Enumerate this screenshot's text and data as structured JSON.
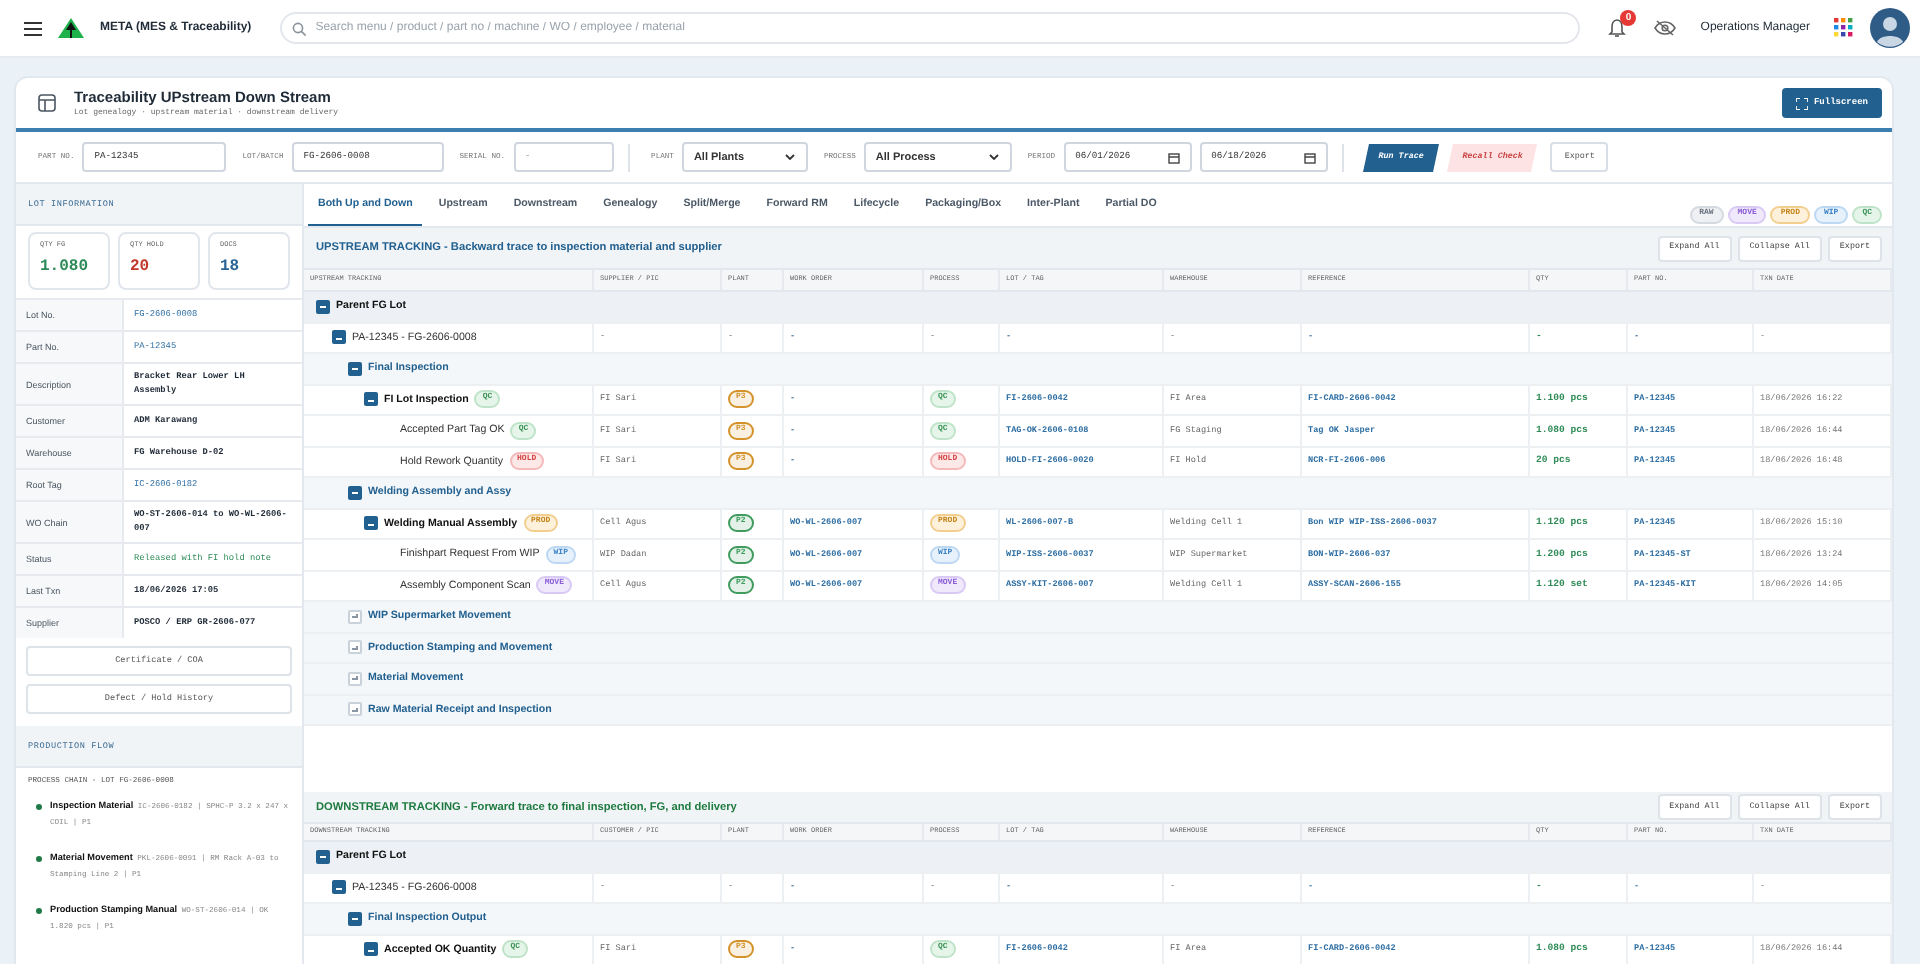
{
  "topbar": {
    "app_title": "META (MES & Traceability)",
    "search": {
      "placeholder": "Search menu / product / part no / machine / WO / employee / material"
    },
    "notification_count": "0",
    "user_name": "Operations Manager"
  },
  "page": {
    "title": "Traceability UPstream Down Stream",
    "subtitle": "Lot genealogy · upstream material · downstream delivery",
    "fullscreen_button": "Fullscreen"
  },
  "filters": [
    {
      "kind": "text",
      "label": "PART NO.",
      "value": "PA-12345"
    },
    {
      "kind": "text",
      "label": "LOT/BATCH",
      "value": "FG-2606-0008"
    },
    {
      "kind": "text",
      "label": "SERIAL NO.",
      "placeholder": "-"
    },
    {
      "kind": "select",
      "label": "PLANT",
      "value": "All Plants"
    },
    {
      "kind": "select",
      "label": "PROCESS",
      "value": "All Process"
    },
    {
      "kind": "daterange",
      "label": "PERIOD",
      "values": [
        "06/01/2026",
        "06/18/2026"
      ]
    }
  ],
  "filter_actions": [
    {
      "kind": "primary",
      "label": "Run Trace"
    },
    {
      "kind": "danger",
      "label": "Recall Check"
    },
    {
      "kind": "plain",
      "label": "Export"
    }
  ],
  "lot_info": {
    "heading": "LOT INFORMATION",
    "stats": [
      {
        "kind": "good",
        "label": "QTY FG",
        "value": "1.080"
      },
      {
        "kind": "bad",
        "label": "QTY HOLD",
        "value": "20"
      },
      {
        "kind": "info",
        "label": "DOCS",
        "value": "18"
      }
    ],
    "fields": [
      {
        "kind": "link",
        "label": "Lot No.",
        "value": "FG-2606-0008"
      },
      {
        "kind": "link",
        "label": "Part No.",
        "value": "PA-12345"
      },
      {
        "kind": "text",
        "label": "Description",
        "value": "Bracket Rear Lower LH Assembly"
      },
      {
        "kind": "text",
        "label": "Customer",
        "value": "ADM Karawang"
      },
      {
        "kind": "text",
        "label": "Warehouse",
        "value": "FG Warehouse D-02"
      },
      {
        "kind": "link",
        "label": "Root Tag",
        "value": "IC-2606-0182"
      },
      {
        "kind": "text",
        "label": "WO Chain",
        "value": "WO-ST-2606-014 to WO-WL-2606-007"
      },
      {
        "kind": "status",
        "label": "Status",
        "value": "Released with FI hold note"
      },
      {
        "kind": "text",
        "label": "Last Txn",
        "value": "18/06/2026 17:05"
      },
      {
        "kind": "text",
        "label": "Supplier",
        "value": "POSCO / ERP GR-2606-077"
      }
    ],
    "buttons": [
      "Certificate / COA",
      "Defect / Hold History"
    ]
  },
  "production_flow": {
    "heading": "PRODUCTION FLOW",
    "chain_title": "PROCESS CHAIN - LOT FG-2606-0008",
    "steps": [
      "**Inspection Material** IC-2606-0182 | SPHC-P 3.2 x 247 x COIL | P1",
      "**Material Movement** PKL-2606-0091 | RM Rack A-03 to Stamping Line 2 | P1",
      "**Production Stamping Manual** WO-ST-2606-014 | OK 1.820 pcs | P1"
    ]
  },
  "tabs": [
    {
      "label": "Both Up and Down",
      "selected": true
    },
    {
      "label": "Upstream",
      "selected": false
    },
    {
      "label": "Downstream",
      "selected": false
    },
    {
      "label": "Genealogy",
      "selected": false
    },
    {
      "label": "Split/Merge",
      "selected": false
    },
    {
      "label": "Forward RM",
      "selected": false
    },
    {
      "label": "Lifecycle",
      "selected": false
    },
    {
      "label": "Packaging/Box",
      "selected": false
    },
    {
      "label": "Inter-Plant",
      "selected": false
    },
    {
      "label": "Partial DO",
      "selected": false
    }
  ],
  "legend": [
    {
      "kind": "raw",
      "text": "RAW"
    },
    {
      "kind": "move",
      "text": "MOVE"
    },
    {
      "kind": "prod",
      "text": "PROD"
    },
    {
      "kind": "wip",
      "text": "WIP"
    },
    {
      "kind": "qc",
      "text": "QC"
    }
  ],
  "sections": [
    {
      "kind": "upstream",
      "title": "UPSTREAM TRACKING - Backward trace to inspection material and supplier",
      "buttons": [
        "Expand All",
        "Collapse All",
        "Export"
      ],
      "columns": [
        "UPSTREAM TRACKING",
        "SUPPLIER / PIC",
        "PLANT",
        "WORK ORDER",
        "PROCESS",
        "LOT / TAG",
        "WAREHOUSE",
        "REFERENCE",
        "QTY",
        "PART NO.",
        "TXN DATE"
      ],
      "rows": [
        {
          "kind": "group",
          "label": "Parent FG Lot",
          "expanded": true,
          "children": [
            {
              "kind": "lot",
              "label": "PA-12345 - FG-2606-0008",
              "expanded": true,
              "cells": [
                "-",
                "-",
                "-",
                "-",
                "-",
                "-",
                "-",
                "-",
                "-",
                "-"
              ],
              "children": [
                {
                  "kind": "section",
                  "label": "Final Inspection",
                  "expanded": true,
                  "children": [
                    {
                      "kind": "item",
                      "label": "FI Lot Inspection",
                      "expanded": true,
                      "tag": {
                        "kind": "qc",
                        "text": "QC"
                      },
                      "cells": [
                        "FI Sari",
                        {
                          "text": "P3",
                          "color": "#d4922a"
                        },
                        "-",
                        {
                          "kind": "qc",
                          "text": "QC"
                        },
                        "FI-2606-0042",
                        "FI Area",
                        "FI-CARD-2606-0042",
                        "1.100 pcs",
                        "PA-12345",
                        "18/06/2026 16:22"
                      ],
                      "children": [
                        {
                          "kind": "item",
                          "label": "Accepted Part Tag OK",
                          "tag": {
                            "kind": "qc",
                            "text": "QC"
                          },
                          "cells": [
                            "FI Sari",
                            {
                              "text": "P3",
                              "color": "#d4922a"
                            },
                            "-",
                            {
                              "kind": "qc",
                              "text": "QC"
                            },
                            "TAG-OK-2606-0108",
                            "FG Staging",
                            "Tag OK Jasper",
                            "1.080 pcs",
                            "PA-12345",
                            "18/06/2026 16:44"
                          ]
                        },
                        {
                          "kind": "item",
                          "label": "Hold Rework Quantity",
                          "tag": {
                            "kind": "hold",
                            "text": "HOLD"
                          },
                          "cells": [
                            "FI Sari",
                            {
                              "text": "P3",
                              "color": "#d4922a"
                            },
                            "-",
                            {
                              "kind": "hold",
                              "text": "HOLD"
                            },
                            "HOLD-FI-2606-0020",
                            "FI Hold",
                            "NCR-FI-2606-006",
                            "20 pcs",
                            "PA-12345",
                            "18/06/2026 16:48"
                          ]
                        }
                      ]
                    }
                  ]
                },
                {
                  "kind": "section",
                  "label": "Welding Assembly and Assy",
                  "expanded": true,
                  "children": [
                    {
                      "kind": "item",
                      "label": "Welding Manual Assembly",
                      "expanded": true,
                      "tag": {
                        "kind": "prod",
                        "text": "PROD"
                      },
                      "cells": [
                        "Cell Agus",
                        {
                          "text": "P2",
                          "color": "#3f9b5e"
                        },
                        "WO-WL-2606-007",
                        {
                          "kind": "prod",
                          "text": "PROD"
                        },
                        "WL-2606-007-B",
                        "Welding Cell 1",
                        "Bon WIP WIP-ISS-2606-0037",
                        "1.120 pcs",
                        "PA-12345",
                        "18/06/2026 15:10"
                      ],
                      "children": [
                        {
                          "kind": "item",
                          "label": "Finishpart Request From WIP",
                          "tag": {
                            "kind": "wip",
                            "text": "WIP"
                          },
                          "cells": [
                            "WIP Dadan",
                            {
                              "text": "P2",
                              "color": "#3f9b5e"
                            },
                            "WO-WL-2606-007",
                            {
                              "kind": "wip",
                              "text": "WIP"
                            },
                            "WIP-ISS-2606-0037",
                            "WIP Supermarket",
                            "BON-WIP-2606-037",
                            "1.200 pcs",
                            "PA-12345-ST",
                            "18/06/2026 13:24"
                          ]
                        },
                        {
                          "kind": "item",
                          "label": "Assembly Component Scan",
                          "tag": {
                            "kind": "move",
                            "text": "MOVE"
                          },
                          "cells": [
                            "Cell Agus",
                            {
                              "text": "P2",
                              "color": "#3f9b5e"
                            },
                            "WO-WL-2606-007",
                            {
                              "kind": "move",
                              "text": "MOVE"
                            },
                            "ASSY-KIT-2606-007",
                            "Welding Cell 1",
                            "ASSY-SCAN-2606-155",
                            "1.120 set",
                            "PA-12345-KIT",
                            "18/06/2026 14:05"
                          ]
                        }
                      ]
                    }
                  ]
                },
                {
                  "kind": "section",
                  "label": "WIP Supermarket Movement",
                  "expanded": false
                },
                {
                  "kind": "section",
                  "label": "Production Stamping and Movement",
                  "expanded": false
                },
                {
                  "kind": "section",
                  "label": "Material Movement",
                  "expanded": false
                },
                {
                  "kind": "section",
                  "label": "Raw Material Receipt and Inspection",
                  "expanded": false
                }
              ]
            }
          ]
        }
      ]
    },
    {
      "kind": "downstream",
      "title": "DOWNSTREAM TRACKING - Forward trace to final inspection, FG, and delivery",
      "buttons": [
        "Expand All",
        "Collapse All",
        "Export"
      ],
      "columns": [
        "DOWNSTREAM TRACKING",
        "CUSTOMER / PIC",
        "PLANT",
        "WORK ORDER",
        "PROCESS",
        "LOT / TAG",
        "WAREHOUSE",
        "REFERENCE",
        "QTY",
        "PART NO.",
        "TXN DATE"
      ],
      "rows": [
        {
          "kind": "group",
          "label": "Parent FG Lot",
          "expanded": true,
          "children": [
            {
              "kind": "lot",
              "label": "PA-12345 - FG-2606-0008",
              "expanded": true,
              "cells": [
                "-",
                "-",
                "-",
                "-",
                "-",
                "-",
                "-",
                "-",
                "-",
                "-"
              ],
              "children": [
                {
                  "kind": "section",
                  "label": "Final Inspection Output",
                  "expanded": true,
                  "children": [
                    {
                      "kind": "item",
                      "label": "Accepted OK Quantity",
                      "expanded": true,
                      "tag": {
                        "kind": "qc",
                        "text": "QC"
                      },
                      "cells": [
                        "FI Sari",
                        {
                          "text": "P3",
                          "color": "#d4922a"
                        },
                        "-",
                        {
                          "kind": "qc",
                          "text": "QC"
                        },
                        "FI-2606-0042",
                        "FI Area",
                        "FI-CARD-2606-0042",
                        "1.080 pcs",
                        "PA-12345",
                        "18/06/2026 16:44"
                      ]
                    }
                  ]
                }
              ]
            }
          ]
        }
      ]
    }
  ]
}
